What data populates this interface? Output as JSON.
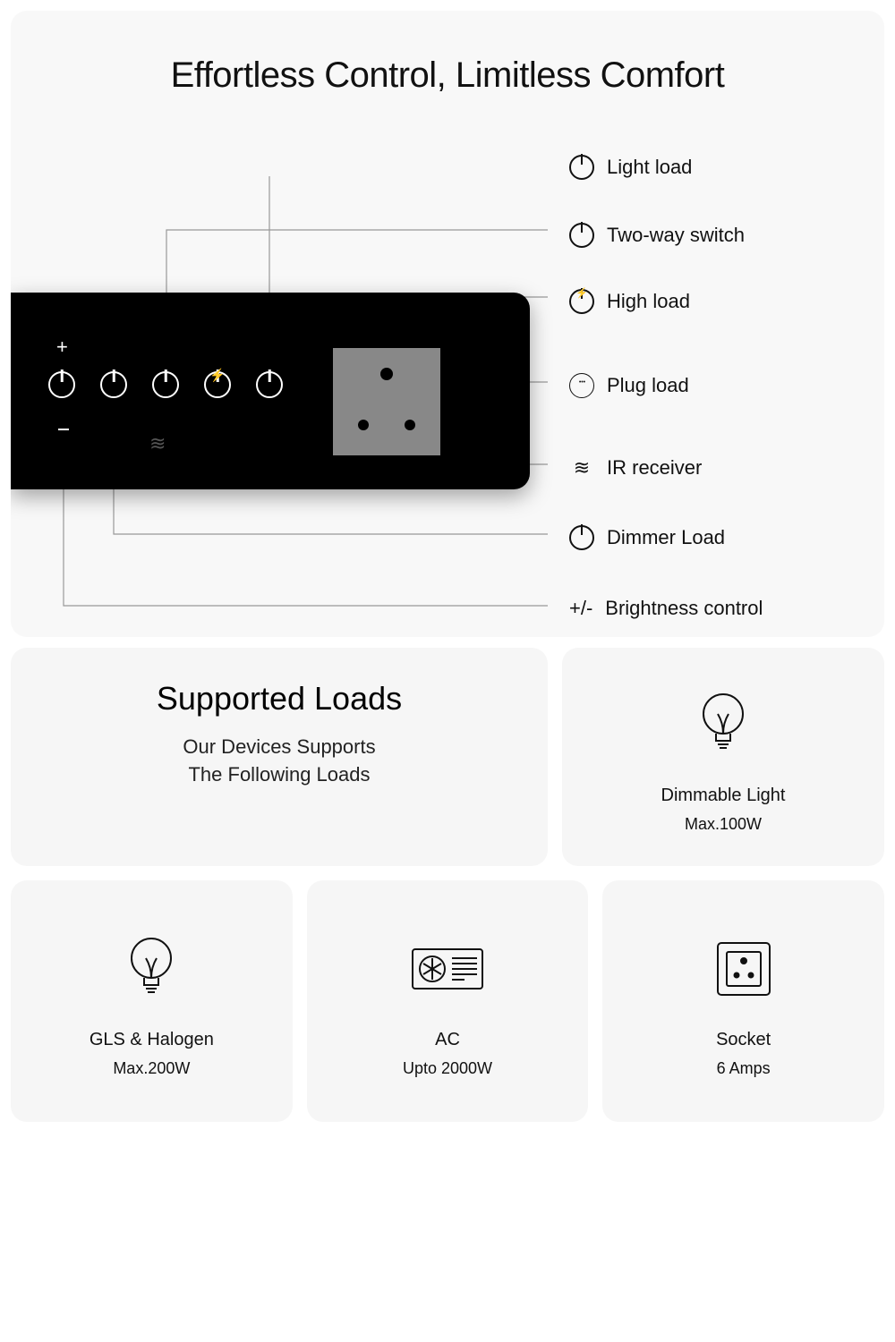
{
  "hero": {
    "title": "Effortless Control, Limitless Comfort"
  },
  "legend": {
    "light": "Light load",
    "twoway": "Two-way switch",
    "high": "High load",
    "plug": "Plug load",
    "ir": "IR receiver",
    "dimmer": "Dimmer Load",
    "brightness_prefix": "+/-",
    "brightness": "Brightness control"
  },
  "supported": {
    "title": "Supported Loads",
    "line1": "Our Devices Supports",
    "line2": "The Following Loads"
  },
  "cards": {
    "dimmable": {
      "title": "Dimmable Light",
      "spec": "Max.100W"
    },
    "gls": {
      "title": "GLS & Halogen",
      "spec": "Max.200W"
    },
    "ac": {
      "title": "AC",
      "spec": "Upto 2000W"
    },
    "socket": {
      "title": "Socket",
      "spec": "6 Amps"
    }
  }
}
